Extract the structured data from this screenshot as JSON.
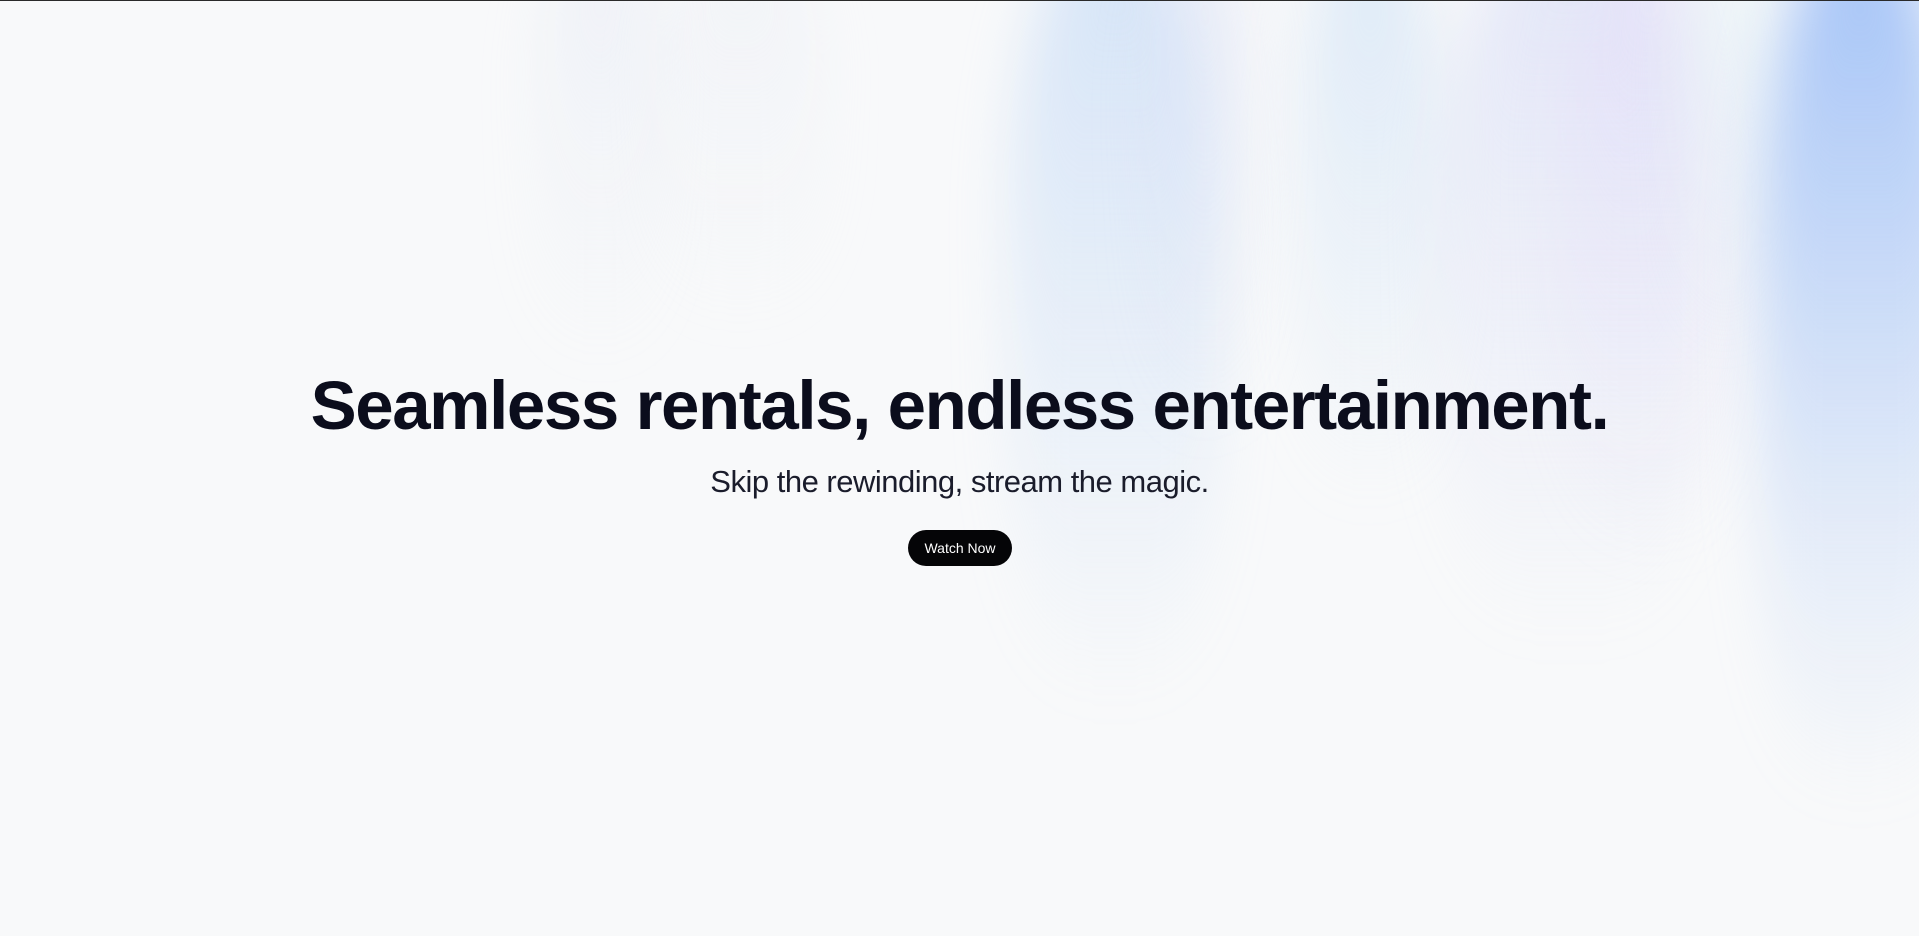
{
  "hero": {
    "headline": "Seamless rentals, endless entertainment.",
    "subheadline": "Skip the rewinding, stream the magic.",
    "cta_label": "Watch Now"
  },
  "colors": {
    "background": "#f8f9fa",
    "headline_text": "#0b0d1c",
    "cta_background": "#050507",
    "cta_text": "#ffffff",
    "accent_blue": "#96baf6"
  }
}
